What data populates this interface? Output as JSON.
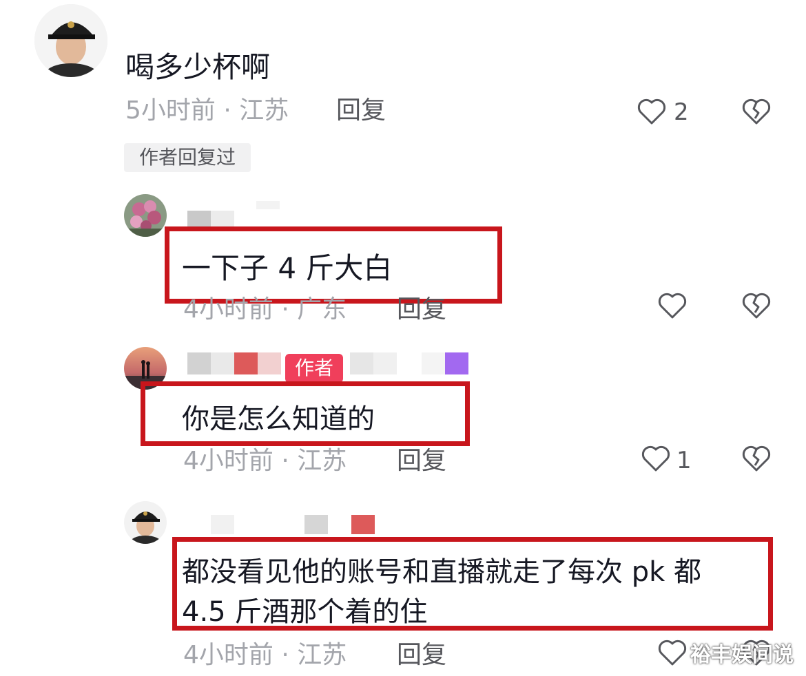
{
  "comments": [
    {
      "text": "喝多少杯啊",
      "time_location": "5小时前 · 江苏",
      "reply_label": "回复",
      "like_count": "2",
      "tag": "作者回复过"
    },
    {
      "text": "一下子 4 斤大白",
      "time_location": "4小时前 · 广东",
      "reply_label": "回复",
      "like_count": ""
    },
    {
      "text": "你是怎么知道的",
      "time_location": "4小时前 · 江苏",
      "reply_label": "回复",
      "like_count": "1",
      "badge": "作者"
    },
    {
      "text_line1": "都没看见他的账号和直播就走了每次 pk 都",
      "text_line2": "4.5 斤酒那个着的住",
      "time_location": "4小时前 · 江苏",
      "reply_label": "回复",
      "like_count": ""
    }
  ],
  "watermark": "裕丰娱间说",
  "icons": {
    "like": "heart-outline-icon",
    "dislike": "broken-heart-icon"
  },
  "colors": {
    "highlight_box": "#c8161c",
    "author_badge": "#f03f5b",
    "meta_text": "#a3a5ab"
  }
}
